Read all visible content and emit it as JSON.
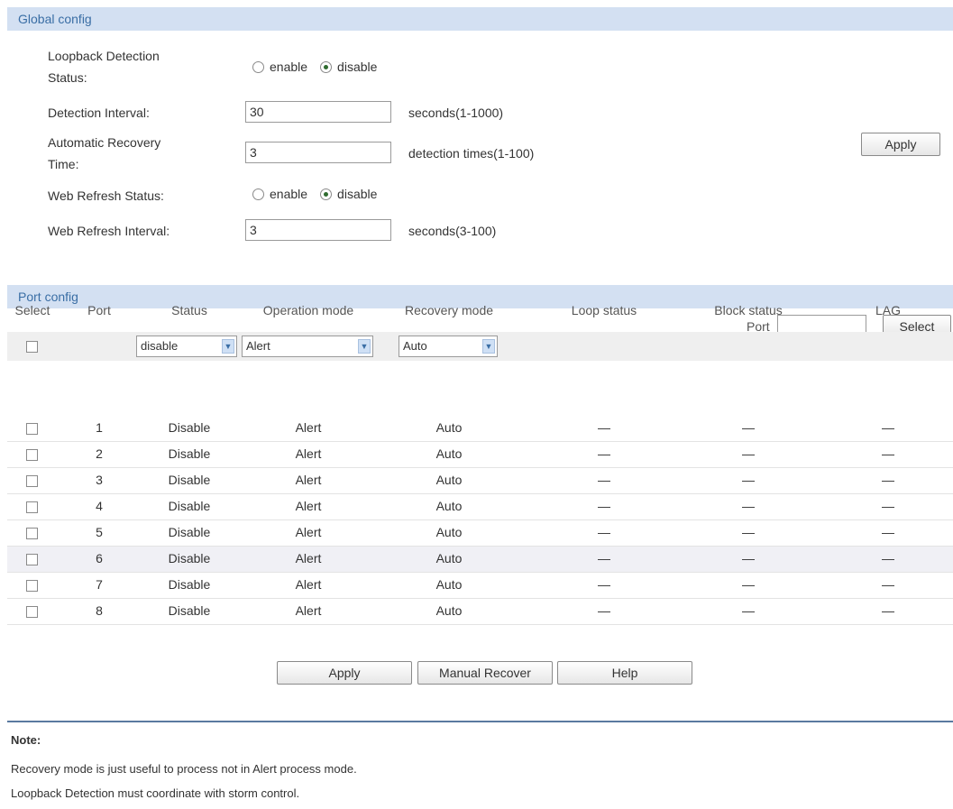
{
  "global": {
    "header": "Global config",
    "loopback_label_1": "Loopback Detection",
    "loopback_label_2": "Status:",
    "enable": "enable",
    "disable": "disable",
    "detection_interval_label": "Detection Interval:",
    "detection_interval_value": "30",
    "detection_interval_hint": "seconds(1-1000)",
    "recovery_label_1": "Automatic Recovery",
    "recovery_label_2": "Time:",
    "recovery_value": "3",
    "recovery_hint": "detection times(1-100)",
    "web_refresh_status_label": "Web Refresh Status:",
    "web_refresh_interval_label": "Web Refresh Interval:",
    "web_refresh_interval_value": "3",
    "web_refresh_interval_hint": "seconds(3-100)",
    "apply": "Apply",
    "loopback_status_selected": "disable",
    "web_refresh_status_selected": "disable"
  },
  "port": {
    "header": "Port config",
    "port_search_label": "Port",
    "port_search_value": "",
    "select_button": "Select",
    "columns": [
      "Select",
      "Port",
      "Status",
      "Operation mode",
      "Recovery mode",
      "Loop status",
      "Block status",
      "LAG"
    ],
    "filter": {
      "status": "disable",
      "operation_mode": "Alert",
      "recovery_mode": "Auto"
    },
    "rows": [
      {
        "port": "1",
        "status": "Disable",
        "operation_mode": "Alert",
        "recovery_mode": "Auto",
        "loop_status": "—",
        "block_status": "—",
        "lag": "—"
      },
      {
        "port": "2",
        "status": "Disable",
        "operation_mode": "Alert",
        "recovery_mode": "Auto",
        "loop_status": "—",
        "block_status": "—",
        "lag": "—"
      },
      {
        "port": "3",
        "status": "Disable",
        "operation_mode": "Alert",
        "recovery_mode": "Auto",
        "loop_status": "—",
        "block_status": "—",
        "lag": "—"
      },
      {
        "port": "4",
        "status": "Disable",
        "operation_mode": "Alert",
        "recovery_mode": "Auto",
        "loop_status": "—",
        "block_status": "—",
        "lag": "—"
      },
      {
        "port": "5",
        "status": "Disable",
        "operation_mode": "Alert",
        "recovery_mode": "Auto",
        "loop_status": "—",
        "block_status": "—",
        "lag": "—"
      },
      {
        "port": "6",
        "status": "Disable",
        "operation_mode": "Alert",
        "recovery_mode": "Auto",
        "loop_status": "—",
        "block_status": "—",
        "lag": "—"
      },
      {
        "port": "7",
        "status": "Disable",
        "operation_mode": "Alert",
        "recovery_mode": "Auto",
        "loop_status": "—",
        "block_status": "—",
        "lag": "—"
      },
      {
        "port": "8",
        "status": "Disable",
        "operation_mode": "Alert",
        "recovery_mode": "Auto",
        "loop_status": "—",
        "block_status": "—",
        "lag": "—"
      }
    ],
    "apply": "Apply",
    "manual_recover": "Manual Recover",
    "help": "Help"
  },
  "note": {
    "title": "Note:",
    "lines": [
      "Recovery mode is just useful to process not in Alert process mode.",
      "Loopback Detection must coordinate with storm control."
    ]
  }
}
